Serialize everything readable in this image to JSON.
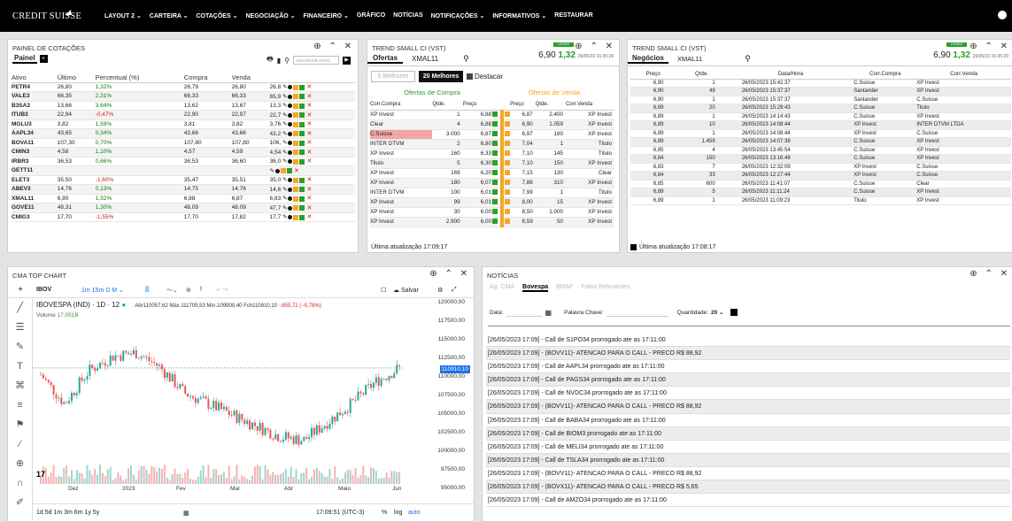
{
  "topbar": {
    "logo": "CREDIT SUISSE",
    "menu": [
      "LAYOUT 2 ⌄",
      "CARTEIRA ⌄",
      "COTAÇÕES ⌄",
      "NEGOCIAÇÃO ⌄",
      "FINANCEIRO ⌄",
      "GRÁFICO",
      "NOTÍCIAS",
      "NOTIFICAÇÕES ⌄",
      "INFORMATIVOS ⌄",
      "RESTAURAR"
    ]
  },
  "painel": {
    "title": "PAINEL DE COTAÇÕES",
    "tab": "Painel",
    "add_placeholder": "ADICIONAR ATIVO",
    "columns": [
      "Ativo",
      "Último",
      "Percentual (%)",
      "Compra",
      "Venda",
      ""
    ],
    "rows": [
      [
        "PETR4",
        "26,80",
        "1,32%",
        "26,79",
        "26,80",
        "26,8"
      ],
      [
        "VALE3",
        "66,35",
        "2,31%",
        "66,33",
        "66,33",
        "65,9"
      ],
      [
        "B3SA3",
        "13,66",
        "3,64%",
        "13,62",
        "13,67",
        "13,3"
      ],
      [
        "ITUB3",
        "22,94",
        "-0,47%",
        "22,90",
        "22,97",
        "22,7"
      ],
      [
        "MGLU3",
        "3,82",
        "1,59%",
        "3,81",
        "3,82",
        "3,76"
      ],
      [
        "AAPL34",
        "43,65",
        "0,34%",
        "43,66",
        "43,66",
        "43,2"
      ],
      [
        "BOVA11",
        "107,30",
        "0,70%",
        "107,80",
        "107,80",
        "106,"
      ],
      [
        "CMIN3",
        "4,58",
        "1,10%",
        "4,57",
        "4,59",
        "4,54"
      ],
      [
        "IRBR3",
        "36,53",
        "0,66%",
        "36,53",
        "36,60",
        "36,0"
      ],
      [
        "GETT11",
        "",
        "",
        "",
        "",
        ""
      ],
      [
        "ELET3",
        "35,50",
        "-1,60%",
        "35,47",
        "35,51",
        "35,0"
      ],
      [
        "ABEV3",
        "14,76",
        "0,13%",
        "14,75",
        "14,76",
        "14,6"
      ],
      [
        "XMAL11",
        "6,90",
        "1,32%",
        "6,88",
        "6,87",
        "6,83"
      ],
      [
        "GOVE11",
        "48,31",
        "1,30%",
        "48,09",
        "48,09",
        "47,7"
      ],
      [
        "CMIG3",
        "17,70",
        "-1,55%",
        "17,70",
        "17,82",
        "17,7"
      ]
    ]
  },
  "ofertas": {
    "title": "TREND SMALL CI (VST)",
    "tab": "Ofertas",
    "symbol": "XMAL11",
    "last": "6,90",
    "change": "1,32",
    "time": "26/05/23 16:35:29",
    "badge": "LIGADO",
    "btn1": "5 Melhores",
    "btn2": "20 Melhores",
    "destacar": "Destacar",
    "buy_head": "Ofertas de Compra",
    "sell_head": "Ofertas de Venda",
    "columns": [
      "Corr.Compra",
      "Qtde.",
      "Preço",
      "",
      "Preço",
      "Qtde.",
      "Corr.Venda"
    ],
    "rows": [
      [
        "XP Invest",
        "1",
        "6,88",
        "6,87",
        "2.400",
        "XP Invest"
      ],
      [
        "Clear",
        "4",
        "6,88",
        "6,90",
        "1.059",
        "XP Invest"
      ],
      [
        "C.Suisse",
        "3.000",
        "6,87",
        "6,97",
        "180",
        "XP Invest"
      ],
      [
        "INTER DTVM",
        "2",
        "6,80",
        "7,04",
        "1",
        "Titulo"
      ],
      [
        "XP Invest",
        "160",
        "6,33",
        "7,10",
        "145",
        "Titulo"
      ],
      [
        "Titulo",
        "5",
        "6,30",
        "7,10",
        "150",
        "XP Invest"
      ],
      [
        "XP Invest",
        "169",
        "6,20",
        "7,15",
        "130",
        "Clear"
      ],
      [
        "XP Invest",
        "180",
        "6,07",
        "7,88",
        "310",
        "XP Invest"
      ],
      [
        "INTER DTVM",
        "100",
        "6,01",
        "7,99",
        "1",
        "Titulo"
      ],
      [
        "XP Invest",
        "99",
        "6,01",
        "8,00",
        "15",
        "XP Invest"
      ],
      [
        "XP Invest",
        "30",
        "6,00",
        "8,50",
        "1.000",
        "XP Invest"
      ],
      [
        "XP Invest",
        "2.800",
        "6,00",
        "8,59",
        "50",
        "XP Invest"
      ]
    ],
    "footer": "Última atualização 17:09:17"
  },
  "negocios": {
    "title": "TREND SMALL CI (VST)",
    "tab": "Negócios",
    "symbol": "XMAL11",
    "last": "6,90",
    "change": "1,32",
    "time": "26/05/23 16:35:29",
    "badge": "LIGADO",
    "columns": [
      "Preço",
      "Qtde.",
      "Data/Hora",
      "Corr.Compra",
      "Corr.Venda"
    ],
    "rows": [
      [
        "6,90",
        "1",
        "26/05/2023 15:42:37",
        "C.Suisse",
        "XP Invest"
      ],
      [
        "6,90",
        "49",
        "26/05/2023 15:37:37",
        "Santander",
        "XP Invest"
      ],
      [
        "6,90",
        "1",
        "26/05/2023 15:37:37",
        "Santander",
        "C.Suisse"
      ],
      [
        "6,89",
        "20",
        "26/05/2023 15:29:43",
        "C.Suisse",
        "Titulo"
      ],
      [
        "6,89",
        "1",
        "26/05/2023 14:14:43",
        "C.Suisse",
        "XP Invest"
      ],
      [
        "6,89",
        "10",
        "26/05/2023 14:08:44",
        "XP Invest",
        "INTER DTVM LTDA"
      ],
      [
        "6,89",
        "1",
        "26/05/2023 14:08:44",
        "XP Invest",
        "C.Suisse"
      ],
      [
        "6,89",
        "1.459",
        "26/05/2023 14:07:38",
        "C.Suisse",
        "XP Invest"
      ],
      [
        "6,85",
        "4",
        "26/05/2023 13:45:54",
        "C.Suisse",
        "XP Invest"
      ],
      [
        "6,84",
        "150",
        "26/05/2023 13:16:48",
        "C.Suisse",
        "XP Invest"
      ],
      [
        "6,83",
        "7",
        "26/05/2023 12:32:09",
        "XP Invest",
        "C.Suisse"
      ],
      [
        "6,84",
        "33",
        "26/05/2023 12:27:44",
        "XP Invest",
        "C.Suisse"
      ],
      [
        "6,85",
        "600",
        "26/05/2023 11:41:07",
        "C.Suisse",
        "Clear"
      ],
      [
        "6,89",
        "5",
        "26/05/2023 11:11:24",
        "C.Suisse",
        "XP Invest"
      ],
      [
        "6,89",
        "1",
        "26/05/2023 11:09:23",
        "Titulo",
        "XP Invest"
      ]
    ],
    "footer": "Última atualização 17:08:17"
  },
  "chart": {
    "title": "CMA TOP CHART",
    "symbol": "IBOV",
    "intervals": "1m  15m  D  M  ⌄",
    "save": "Salvar",
    "legend_name": "IBOVESPA (IND) · 1D · 12",
    "ohlc": "Abr110057,62  Máx.111705,53  Mín.109900,40  Fch110910,10",
    "change": "−855,72 (−0,78%)",
    "vol_label": "Volume",
    "vol_value": "17,051B",
    "current": "110910,10",
    "y_ticks": [
      "120000,00",
      "117500,00",
      "115000,00",
      "112500,00",
      "110000,00",
      "107500,00",
      "105000,00",
      "102500,00",
      "100000,00",
      "97500,00",
      "95000,00"
    ],
    "x_ticks": [
      "Dez",
      "2023",
      "Fev",
      "Mar",
      "Abr",
      "Maio",
      "Jun"
    ],
    "ranges": "1d  5d  1m  3m  6m  1y  5y",
    "clock": "17:09:51 (UTC-3)",
    "pct": "%",
    "log": "log",
    "auto": "auto",
    "colors": {
      "up": "#26a69a",
      "down": "#ef5350"
    }
  },
  "chart_data": {
    "type": "line",
    "title": "IBOVESPA (IND) · 1D · 12",
    "ylim": [
      95000,
      120000
    ],
    "x": [
      "Dez",
      "2023",
      "Fev",
      "Mar",
      "Abr",
      "Maio",
      "Jun"
    ],
    "series": [
      {
        "name": "IBOV",
        "values": [
          110000,
          106000,
          110500,
          112500,
          113000,
          111000,
          107500,
          106000,
          104500,
          103000,
          101500,
          101000,
          103500,
          106000,
          109000,
          110910
        ]
      }
    ]
  },
  "news": {
    "title": "NOTÍCIAS",
    "tabs": [
      "Ag. CMA",
      "Bovespa",
      "BM&F",
      "Fatos Relevantes"
    ],
    "data_label": "Data:",
    "keyword_label": "Palavra Chave:",
    "qty_label": "Quantidade:",
    "qty_value": "20 ⌄",
    "items": [
      "[26/05/2023 17:09] - Call de S1PO34 prorrogado ate as 17:11:00",
      "[26/05/2023 17:09] - (BOVV11)- ATENCAO PARA O CALL - PRECO R$ 88,92",
      "[26/05/2023 17:09] - Call de AAPL34 prorrogado ate as 17:11:00",
      "[26/05/2023 17:09] - Call de PAGS34 prorrogado ate as 17:11:00",
      "[26/05/2023 17:09] - Call de NVDC34 prorrogado ate as 17:11:00",
      "[26/05/2023 17:09] - (BOVV11)- ATENCAO PARA O CALL - PRECO R$ 88,92",
      "[26/05/2023 17:09] - Call de BABA34 prorrogado ate as 17:11:00",
      "[26/05/2023 17:09] - Call de BIOM3 prorrogado ate as 17:11:00",
      "[26/05/2023 17:09] - Call de MELI34 prorrogado ate as 17:11:00",
      "[26/05/2023 17:09] - Call de TSLA34 prorrogado ate as 17:11:00",
      "[26/05/2023 17:09] - (BOVV11)- ATENCAO PARA O CALL - PRECO R$ 88,92",
      "[26/05/2023 17:09] - (BOVX11)- ATENCAO PARA O CALL - PRECO R$ 5,65",
      "[26/05/2023 17:09] - Call de AMZO34 prorrogado ate as 17:11:00"
    ]
  }
}
